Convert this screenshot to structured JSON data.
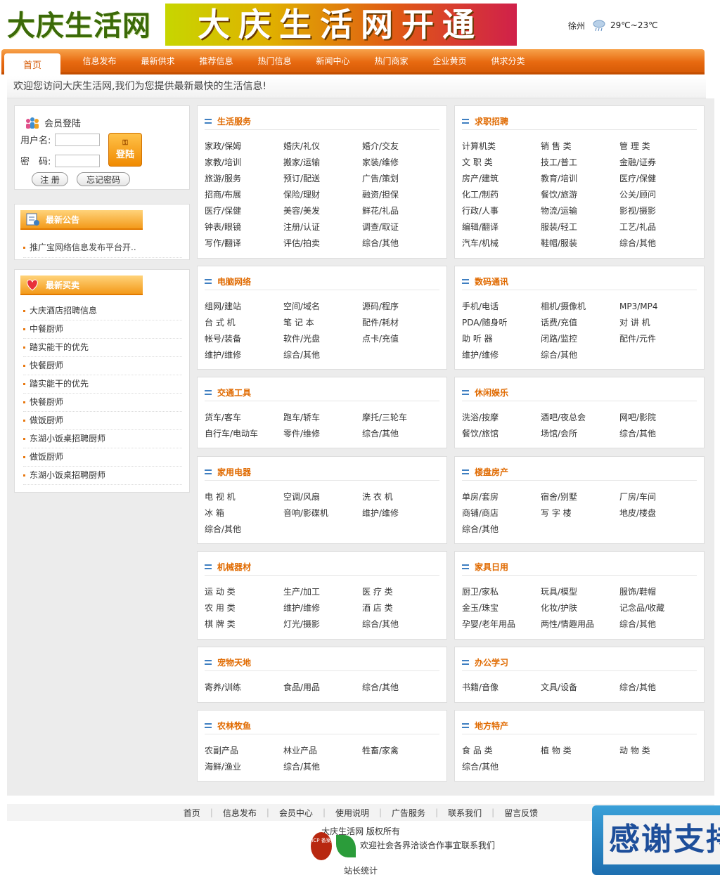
{
  "header": {
    "logo_text": "大庆生活网",
    "banner_text": "大庆生活网开通",
    "weather": {
      "city": "徐州",
      "icon": "cloud-rain-icon",
      "temp": "29℃~23℃"
    }
  },
  "nav": {
    "items": [
      "首页",
      "信息发布",
      "最新供求",
      "推荐信息",
      "热门信息",
      "新闻中心",
      "热门商家",
      "企业黄页",
      "供求分类"
    ]
  },
  "welcome": "欢迎您访问大庆生活网,我们为您提供最新最快的生活信息!",
  "login": {
    "title": "会员登陆",
    "username_label": "用户名:",
    "password_label": "密　码:",
    "login_button": "登陆",
    "register_button": "注 册",
    "forgot_button": "忘记密码"
  },
  "notice": {
    "title": "最新公告",
    "items": [
      "推广宝网络信息发布平台开.."
    ]
  },
  "buy": {
    "title": "最新买卖",
    "items": [
      "大庆酒店招聘信息",
      "中餐厨师",
      "踏实能干的优先",
      "快餐厨师",
      "踏实能干的优先",
      "快餐厨师",
      "做饭厨师",
      "东湖小饭桌招聘厨师",
      "做饭厨师",
      "东湖小饭桌招聘厨师"
    ]
  },
  "categories": [
    {
      "title": "生活服务",
      "items": [
        "家政/保姆",
        "婚庆/礼仪",
        "婚介/交友",
        "家教/培训",
        "搬家/运输",
        "家装/维修",
        "旅游/服务",
        "预订/配送",
        "广告/策划",
        "招商/布展",
        "保险/理财",
        "融资/担保",
        "医疗/保健",
        "美容/美发",
        "鲜花/礼品",
        "钟表/眼镜",
        "注册/认证",
        "调查/取证",
        "写作/翻译",
        "评估/拍卖",
        "综合/其他"
      ]
    },
    {
      "title": "求职招聘",
      "items": [
        "计算机类",
        "销 售 类",
        "管 理 类",
        "文 职 类",
        "技工/普工",
        "金融/证券",
        "房产/建筑",
        "教育/培训",
        "医疗/保健",
        "化工/制药",
        "餐饮/旅游",
        "公关/顾问",
        "行政/人事",
        "物流/运输",
        "影视/摄影",
        "编辑/翻译",
        "服装/轻工",
        "工艺/礼品",
        "汽车/机械",
        "鞋帽/服装",
        "综合/其他"
      ]
    },
    {
      "title": "电脑网络",
      "items": [
        "组网/建站",
        "空间/域名",
        "源码/程序",
        "台 式 机",
        "笔 记 本",
        "配件/耗材",
        "帐号/装备",
        "软件/光盘",
        "点卡/充值",
        "维护/维修",
        "综合/其他"
      ]
    },
    {
      "title": "数码通讯",
      "items": [
        "手机/电话",
        "相机/摄像机",
        "MP3/MP4",
        "PDA/随身听",
        "话费/充值",
        "对 讲 机",
        "助 听 器",
        "闭路/监控",
        "配件/元件",
        "维护/维修",
        "综合/其他"
      ]
    },
    {
      "title": "交通工具",
      "items": [
        "货车/客车",
        "跑车/轿车",
        "摩托/三轮车",
        "自行车/电动车",
        "零件/维修",
        "综合/其他"
      ]
    },
    {
      "title": "休闲娱乐",
      "items": [
        "洗浴/按摩",
        "酒吧/夜总会",
        "网吧/影院",
        "餐饮/旅馆",
        "场馆/会所",
        "综合/其他"
      ]
    },
    {
      "title": "家用电器",
      "items": [
        "电 视 机",
        "空调/风扇",
        "洗 衣 机",
        "冰 箱",
        "音响/影碟机",
        "维护/维修",
        "综合/其他"
      ]
    },
    {
      "title": "楼盘房产",
      "items": [
        "单房/套房",
        "宿舍/别墅",
        "厂房/车间",
        "商铺/商店",
        "写 字 楼",
        "地皮/楼盘",
        "综合/其他"
      ]
    },
    {
      "title": "机械器材",
      "items": [
        "运 动 类",
        "生产/加工",
        "医 疗 类",
        "农 用 类",
        "维护/维修",
        "酒 店 类",
        "棋 牌 类",
        "灯光/摄影",
        "综合/其他"
      ]
    },
    {
      "title": "家具日用",
      "items": [
        "厨卫/家私",
        "玩具/模型",
        "服饰/鞋帽",
        "金玉/珠宝",
        "化妆/护肤",
        "记念品/收藏",
        "孕婴/老年用品",
        "两性/情趣用品",
        "综合/其他"
      ]
    },
    {
      "title": "宠物天地",
      "items": [
        "寄养/训练",
        "食品/用品",
        "综合/其他"
      ]
    },
    {
      "title": "办公学习",
      "items": [
        "书籍/音像",
        "文具/设备",
        "综合/其他"
      ]
    },
    {
      "title": "农林牧鱼",
      "items": [
        "农副产品",
        "林业产品",
        "牲畜/家禽",
        "海鲜/渔业",
        "综合/其他"
      ]
    },
    {
      "title": "地方特产",
      "items": [
        "食 品 类",
        "植 物 类",
        "动 物 类",
        "综合/其他"
      ]
    }
  ],
  "footer": {
    "links": [
      "首页",
      "信息发布",
      "会员中心",
      "使用说明",
      "广告服务",
      "联系我们",
      "留言反馈"
    ],
    "copyright": "大庆生活网 版权所有",
    "contact": "欢迎社会各界洽谈合作事宜联系我们",
    "icp_badge": "ICP 备案",
    "stats": "站长统计",
    "thanks_text": "感谢支持"
  },
  "colors": {
    "nav": "#e86a10",
    "accent": "#e06a00",
    "logo": "#3b6a08",
    "bars": "#3f7fc1"
  }
}
